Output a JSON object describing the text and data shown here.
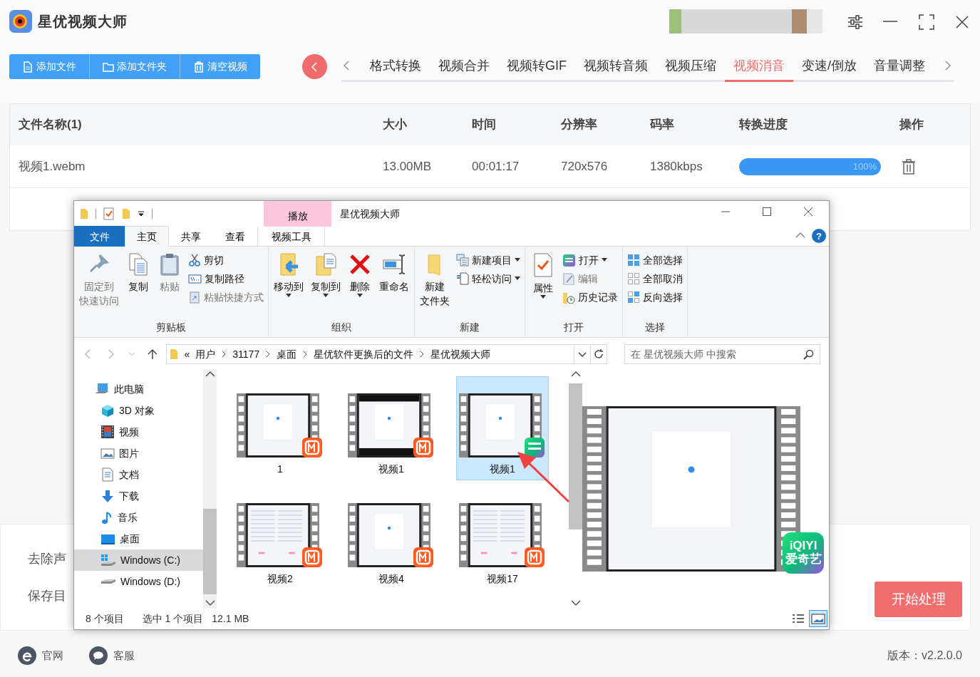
{
  "app": {
    "title": "星优视频大师"
  },
  "toolbar_buttons": [
    {
      "label": "添加文件"
    },
    {
      "label": "添加文件夹"
    },
    {
      "label": "清空视频"
    }
  ],
  "tabs": [
    {
      "label": "格式转换",
      "selected": false
    },
    {
      "label": "视频合并",
      "selected": false
    },
    {
      "label": "视频转GIF",
      "selected": false
    },
    {
      "label": "视频转音频",
      "selected": false
    },
    {
      "label": "视频压缩",
      "selected": false
    },
    {
      "label": "视频消音",
      "selected": true
    },
    {
      "label": "变速/倒放",
      "selected": false
    },
    {
      "label": "音量调整",
      "selected": false
    }
  ],
  "table": {
    "columns": [
      "文件名称(1)",
      "大小",
      "时间",
      "分辨率",
      "码率",
      "转换进度",
      "操作"
    ],
    "rows": [
      {
        "name": "视频1.webm",
        "size": "13.00MB",
        "time": "00:01:17",
        "resolution": "720x576",
        "bitrate": "1380kbps",
        "progress": {
          "level": 1,
          "reading": "100%"
        }
      }
    ]
  },
  "settings": [
    {
      "label": "去除声"
    },
    {
      "label": "保存目"
    }
  ],
  "start_button": {
    "label": "开始处理"
  },
  "footer": {
    "links": [
      {
        "label": "官网"
      },
      {
        "label": "客服"
      }
    ],
    "version": "版本：v2.2.0.0"
  },
  "explorer": {
    "title": "星优视频大师",
    "context_tab": "播放",
    "ribbon_tabs": [
      {
        "label": "文件",
        "kind": "file",
        "selected": false
      },
      {
        "label": "主页",
        "kind": "tab",
        "selected": true
      },
      {
        "label": "共享",
        "kind": "tab",
        "selected": false
      },
      {
        "label": "查看",
        "kind": "tab",
        "selected": false
      },
      {
        "label": "视频工具",
        "kind": "context",
        "selected": false
      }
    ],
    "help": "?",
    "ribbon_groups": [
      {
        "name": "剪贴板",
        "items": [
          {
            "kind": "large",
            "lines": [
              "固定到",
              "快速访问"
            ],
            "disabled": true,
            "dropdown": false
          },
          {
            "kind": "large",
            "lines": [
              "复制"
            ],
            "disabled": false,
            "dropdown": false
          },
          {
            "kind": "large",
            "lines": [
              "粘贴"
            ],
            "disabled": true,
            "dropdown": false
          },
          {
            "kind": "small",
            "lines": [
              "剪切"
            ],
            "disabled": false,
            "dropdown": false
          },
          {
            "kind": "small",
            "lines": [
              "复制路径"
            ],
            "disabled": false,
            "dropdown": false
          },
          {
            "kind": "small",
            "lines": [
              "粘贴快捷方式"
            ],
            "disabled": true,
            "dropdown": false
          }
        ]
      },
      {
        "name": "组织",
        "items": [
          {
            "kind": "large",
            "lines": [
              "移动到"
            ],
            "disabled": false,
            "dropdown": true
          },
          {
            "kind": "large",
            "lines": [
              "复制到"
            ],
            "disabled": false,
            "dropdown": true
          },
          {
            "kind": "large",
            "lines": [
              "删除"
            ],
            "disabled": false,
            "dropdown": true
          },
          {
            "kind": "large",
            "lines": [
              "重命名"
            ],
            "disabled": false,
            "dropdown": false
          }
        ]
      },
      {
        "name": "新建",
        "items": [
          {
            "kind": "large",
            "lines": [
              "新建",
              "文件夹"
            ],
            "disabled": false,
            "dropdown": false
          },
          {
            "kind": "small",
            "lines": [
              "新建项目"
            ],
            "disabled": false,
            "dropdown": true
          },
          {
            "kind": "small",
            "lines": [
              "轻松访问"
            ],
            "disabled": false,
            "dropdown": true
          }
        ]
      },
      {
        "name": "打开",
        "items": [
          {
            "kind": "large",
            "lines": [
              "属性"
            ],
            "disabled": false,
            "dropdown": true
          },
          {
            "kind": "small",
            "lines": [
              "打开"
            ],
            "disabled": false,
            "dropdown": true
          },
          {
            "kind": "small",
            "lines": [
              "编辑"
            ],
            "disabled": true,
            "dropdown": false
          },
          {
            "kind": "small",
            "lines": [
              "历史记录"
            ],
            "disabled": false,
            "dropdown": false
          }
        ]
      },
      {
        "name": "选择",
        "items": [
          {
            "kind": "small",
            "lines": [
              "全部选择"
            ],
            "disabled": false,
            "dropdown": false
          },
          {
            "kind": "small",
            "lines": [
              "全部取消"
            ],
            "disabled": false,
            "dropdown": false
          },
          {
            "kind": "small",
            "lines": [
              "反向选择"
            ],
            "disabled": false,
            "dropdown": false
          }
        ]
      }
    ],
    "address": {
      "prefix": "«",
      "crumbs": [
        "用户",
        "31177",
        "桌面",
        "星优软件更换后的文件",
        "星优视频大师"
      ]
    },
    "search": {
      "placeholder": "在 星优视频大师 中搜索"
    },
    "nav": [
      {
        "label": "此电脑",
        "selected": false,
        "children": [
          {
            "label": "3D 对象",
            "selected": false
          },
          {
            "label": "视频",
            "selected": false
          },
          {
            "label": "图片",
            "selected": false
          },
          {
            "label": "文档",
            "selected": false
          },
          {
            "label": "下载",
            "selected": false
          },
          {
            "label": "音乐",
            "selected": false
          },
          {
            "label": "桌面",
            "selected": false
          },
          {
            "label": "Windows (C:)",
            "selected": true
          },
          {
            "label": "Windows (D:)",
            "selected": false
          }
        ]
      }
    ],
    "files": [
      {
        "name": "1",
        "kind": "mango",
        "selected": false
      },
      {
        "name": "视频1",
        "kind": "mango",
        "selected": false
      },
      {
        "name": "视频1",
        "kind": "iqiyi",
        "selected": true
      },
      {
        "name": "视频2",
        "kind": "mango",
        "selected": false
      },
      {
        "name": "视频4",
        "kind": "mango",
        "selected": false
      },
      {
        "name": "视频17",
        "kind": "mango",
        "selected": false
      }
    ],
    "preview": {
      "badge_lines": [
        "iQIYI",
        "爱奇艺"
      ]
    },
    "status": [
      "8 个项目",
      "选中 1 个项目",
      "12.1 MB"
    ],
    "view_buttons": [
      {
        "kind": "details",
        "selected": false
      },
      {
        "kind": "thumbnails",
        "selected": true
      }
    ]
  }
}
